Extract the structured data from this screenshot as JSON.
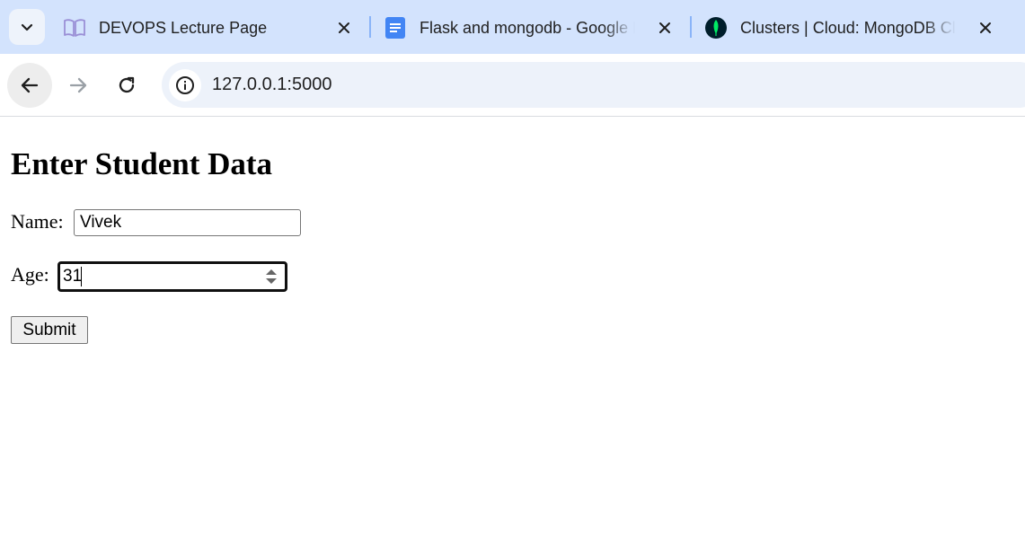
{
  "browser": {
    "tabs": [
      {
        "title": "DEVOPS Lecture Page",
        "icon": "book-icon"
      },
      {
        "title": "Flask and mongodb - Google Docs",
        "icon": "google-docs-icon"
      },
      {
        "title": "Clusters | Cloud: MongoDB Cloud",
        "icon": "mongodb-leaf-icon"
      }
    ],
    "url": "127.0.0.1:5000"
  },
  "page": {
    "heading": "Enter Student Data",
    "name_label": "Name:",
    "name_value": "Vivek",
    "age_label": "Age:",
    "age_value": "31",
    "submit_label": "Submit"
  }
}
